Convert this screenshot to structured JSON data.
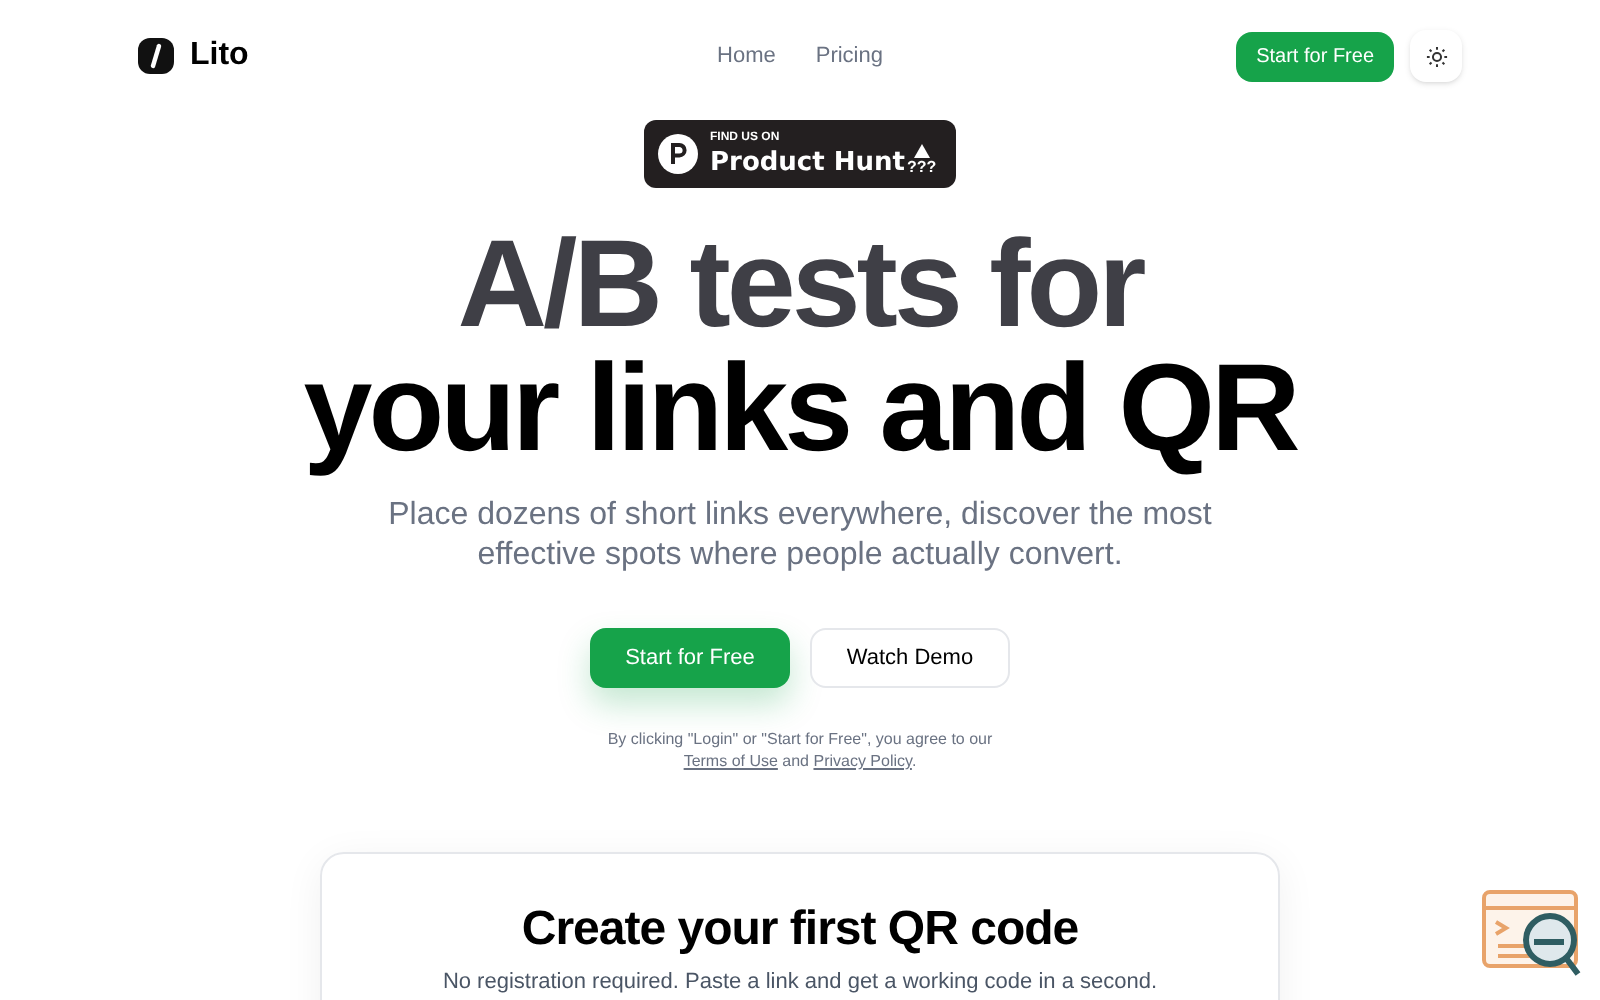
{
  "header": {
    "brand": "Lito",
    "nav": [
      "Home",
      "Pricing"
    ],
    "cta": "Start for Free"
  },
  "badge": {
    "kicker": "FIND US ON",
    "title": "Product Hunt",
    "count": "???"
  },
  "hero": {
    "title_lines": [
      "A/B tests for",
      "your links and QR"
    ],
    "subtitle": "Place dozens of short links everywhere, discover the most effective spots where people actually convert.",
    "primary": "Start for Free",
    "secondary": "Watch Demo",
    "legal": "By clicking \"Login\" or \"Start for Free\", you agree to our",
    "links": [
      "Terms of Use",
      "Privacy Policy"
    ],
    "legal_joiner": "and",
    "legal_end": "."
  },
  "card": {
    "title": "Create your first QR code",
    "text": "No registration required. Paste a link and get a working code in a second."
  }
}
